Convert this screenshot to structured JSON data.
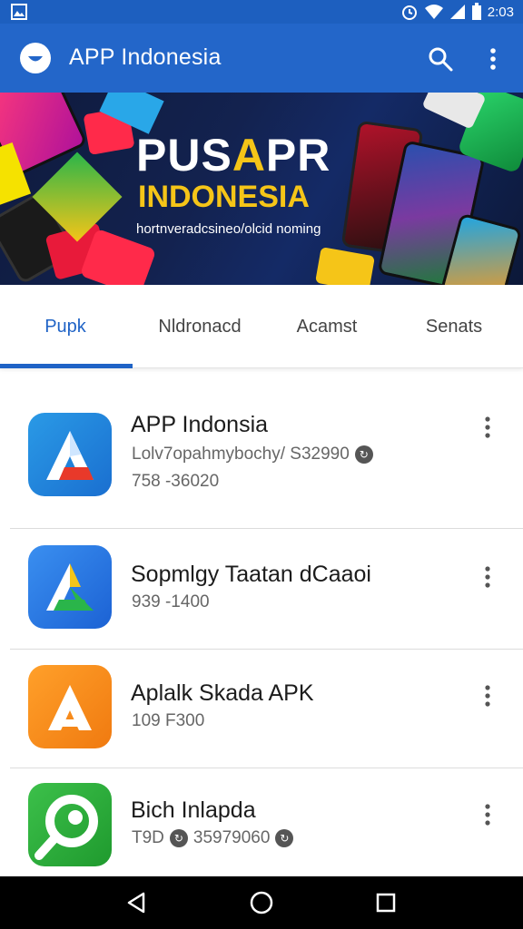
{
  "status_bar": {
    "time": "2:03",
    "icons": [
      "gallery-icon",
      "alarm-icon",
      "wifi-icon",
      "signal-icon",
      "battery-icon"
    ],
    "color": "#1d5fbf"
  },
  "app_bar": {
    "title": "APP Indonesia",
    "color": "#2366c9",
    "icons": [
      "app-logo-icon",
      "search-icon",
      "more-vert-icon"
    ]
  },
  "banner": {
    "title_part1": "PUS",
    "title_accent": "A",
    "title_part2": "PR",
    "subtitle": "INDONESIA",
    "tagline": "hortnveradcsineo/olcid noming",
    "accent_color": "#f5c518"
  },
  "tabs": [
    {
      "label": "Pupk",
      "active": true
    },
    {
      "label": "Nldronacd",
      "active": false
    },
    {
      "label": "Acamst",
      "active": false
    },
    {
      "label": "Senats",
      "active": false
    }
  ],
  "apps": [
    {
      "name": "APP Indonsia",
      "meta_line1": "Lolv7opahmybochy/ S32990",
      "meta_line2": "758 -36020",
      "icon_name": "app-indonsia-icon",
      "icon_colors": [
        "#2a8fe0",
        "#1a6fd0"
      ]
    },
    {
      "name": "Sopmlgy Taatan dCaaoi",
      "meta_line1": "939 -1400",
      "icon_name": "sopmlgy-icon",
      "icon_colors": [
        "#3a8ff0",
        "#1c62d4"
      ]
    },
    {
      "name": "Aplalk Skada APK",
      "meta_line1": "109 F300",
      "icon_name": "aplalk-icon",
      "icon_colors": [
        "#ffa02a",
        "#f07a10"
      ]
    },
    {
      "name": "Bich Inlapda",
      "meta_prefix": "T9D",
      "meta_value": "35979060",
      "icon_name": "bich-icon",
      "icon_colors": [
        "#3cc04a",
        "#1f9a2e"
      ]
    }
  ],
  "nav_bar": {
    "buttons": [
      "back-icon",
      "home-icon",
      "recents-icon"
    ]
  }
}
